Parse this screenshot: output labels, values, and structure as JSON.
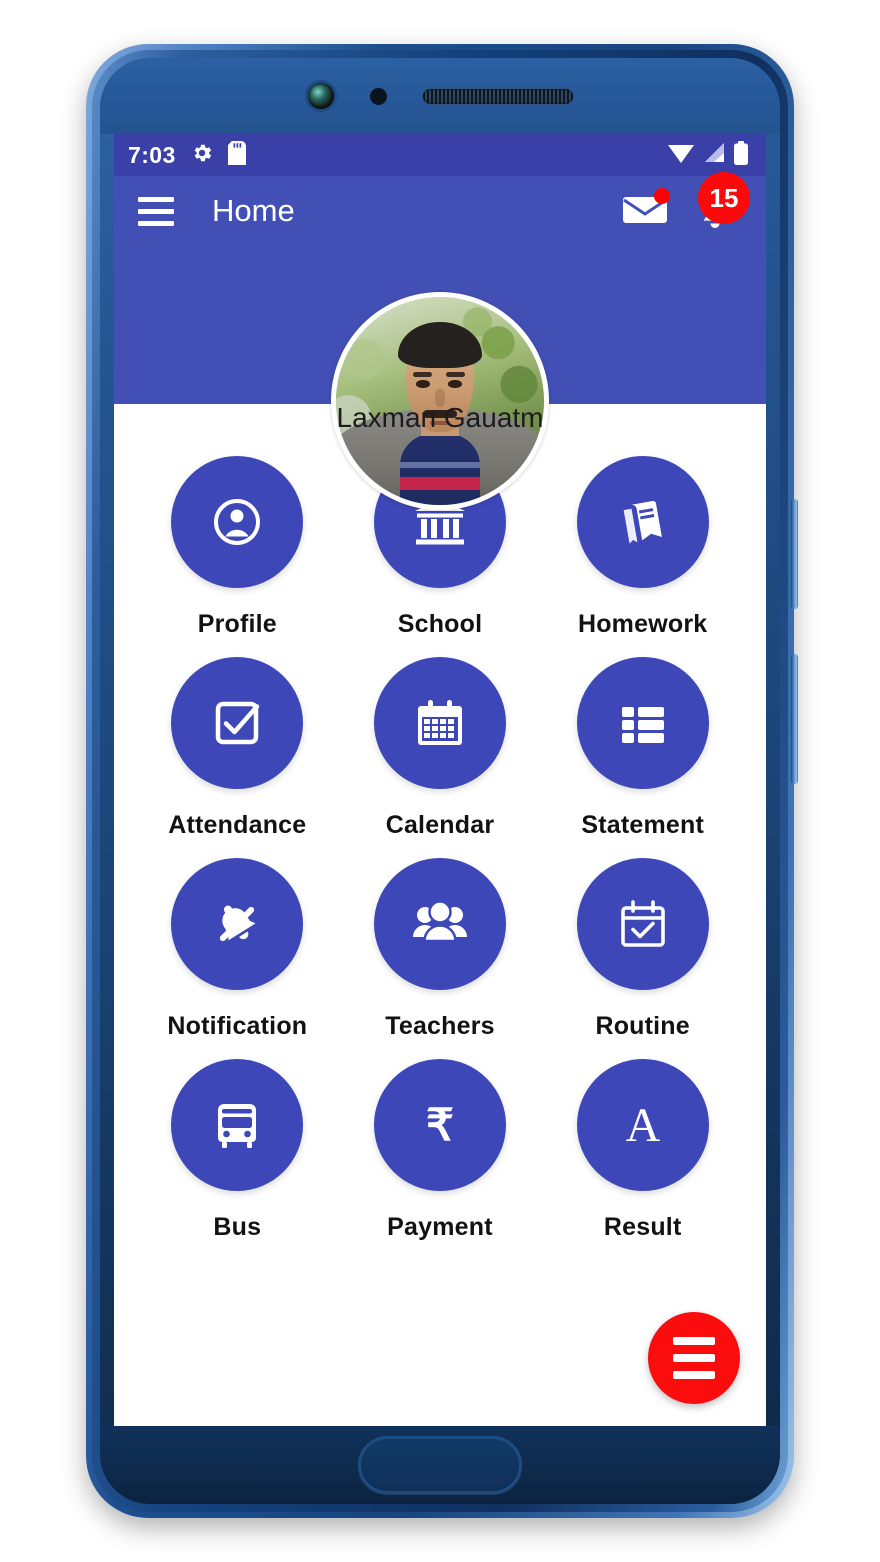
{
  "status_bar": {
    "time": "7:03",
    "icons": [
      "gear-icon",
      "sd-card-icon",
      "wifi-icon",
      "signal-icon",
      "battery-icon"
    ]
  },
  "app_bar": {
    "menu_icon": "hamburger-icon",
    "title": "Home",
    "mail_icon": "envelope-icon",
    "mail_has_dot": true,
    "bell_icon": "bell-icon",
    "notification_count": "15"
  },
  "profile": {
    "name": "Laxman Gauatm",
    "avatar": "user-photo"
  },
  "grid": {
    "tiles": [
      {
        "label": "Profile",
        "icon": "user-circle-icon"
      },
      {
        "label": "School",
        "icon": "bank-building-icon"
      },
      {
        "label": "Homework",
        "icon": "book-icon"
      },
      {
        "label": "Attendance",
        "icon": "checkbox-check-icon"
      },
      {
        "label": "Calendar",
        "icon": "calendar-icon"
      },
      {
        "label": "Statement",
        "icon": "list-view-icon"
      },
      {
        "label": "Notification",
        "icon": "bell-off-icon"
      },
      {
        "label": "Teachers",
        "icon": "people-group-icon"
      },
      {
        "label": "Routine",
        "icon": "calendar-check-icon"
      },
      {
        "label": "Bus",
        "icon": "bus-icon"
      },
      {
        "label": "Payment",
        "icon": "rupee-icon"
      },
      {
        "label": "Result",
        "icon": "letter-a-icon"
      }
    ]
  },
  "fab": {
    "icon": "menu-lines-icon"
  },
  "colors": {
    "status_bar": "#3b3fa8",
    "app_bar": "#4250b6",
    "tile_circle": "#3d47b7",
    "badge": "#fa0a0a",
    "fab": "#fb0d0d",
    "label_text": "#121212"
  }
}
